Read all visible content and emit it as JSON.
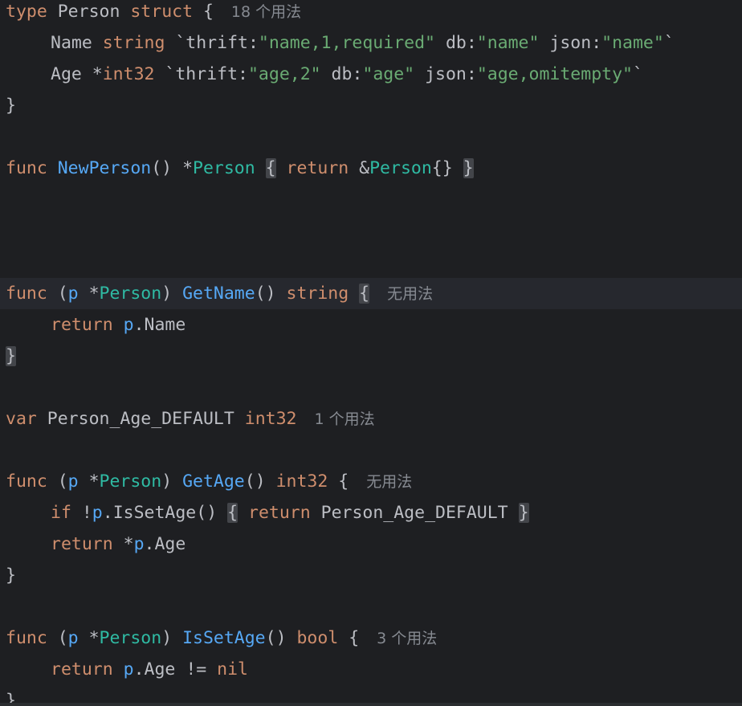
{
  "editor": {
    "language": "Go",
    "hints": {
      "usages_18": "18 个用法",
      "no_usages": "无用法",
      "usages_1": "1 个用法",
      "usages_3": "3 个用法"
    },
    "tokens": {
      "type": "type",
      "struct": "struct",
      "func": "func",
      "return": "return",
      "var": "var",
      "if": "if",
      "string": "string",
      "int32": "int32",
      "bool": "bool",
      "nil": "nil",
      "Person": "Person",
      "NewPerson": "NewPerson",
      "GetName": "GetName",
      "GetAge": "GetAge",
      "IsSetAge": "IsSetAge",
      "Name": "Name",
      "Age": "Age",
      "p": "p",
      "Person_Age_DEFAULT": "Person_Age_DEFAULT",
      "thrift": "thrift",
      "db": "db",
      "json": "json",
      "tag_name_thrift": "\"name,1,required\"",
      "tag_name_db": "\"name\"",
      "tag_name_json": "\"name\"",
      "tag_age_thrift": "\"age,2\"",
      "tag_age_db": "\"age\"",
      "tag_age_json": "\"age,omitempty\""
    }
  }
}
